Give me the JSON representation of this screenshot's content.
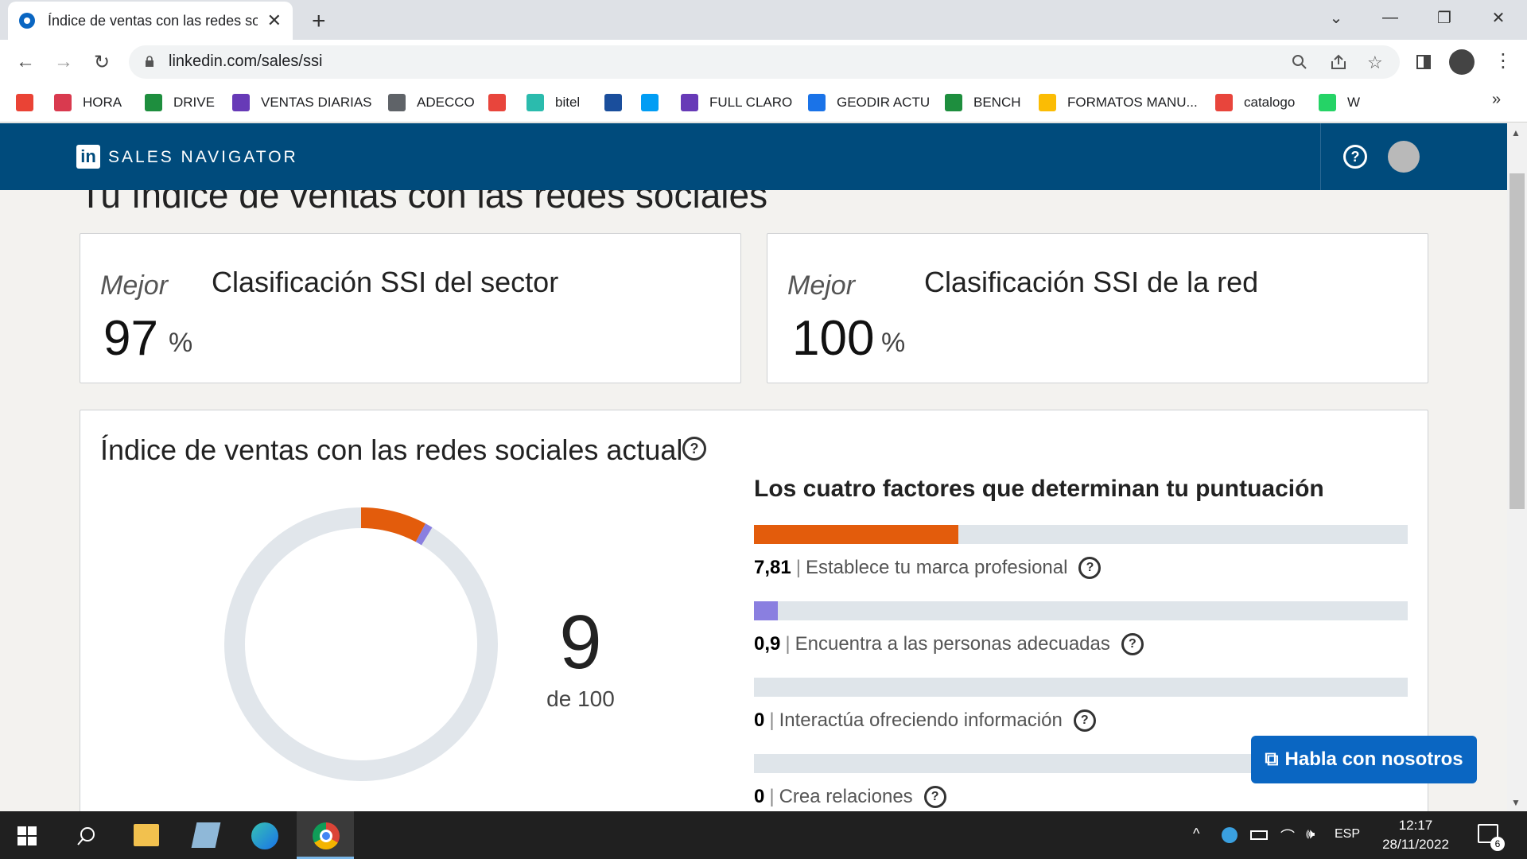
{
  "browser": {
    "tab_title": "Índice de ventas con las redes sociales",
    "new_tab": "+",
    "url": "linkedin.com/sales/ssi",
    "bookmarks": [
      {
        "label": "",
        "icon": "gmail-icon",
        "color": "#ea4335"
      },
      {
        "label": "HORA",
        "icon": "bookmark-icon",
        "color": "#d93a4f"
      },
      {
        "label": "DRIVE",
        "icon": "sheets-icon",
        "color": "#1e8e3e"
      },
      {
        "label": "VENTAS DIARIAS",
        "icon": "forms-icon",
        "color": "#673ab7"
      },
      {
        "label": "ADECCO",
        "icon": "globe-icon",
        "color": "#5f6368"
      },
      {
        "label": "",
        "icon": "people-icon",
        "color": "#e8453c"
      },
      {
        "label": "bitel",
        "icon": "chat-icon",
        "color": "#2bbbad"
      },
      {
        "label": "",
        "icon": "e-icon",
        "color": "#1a4e9c"
      },
      {
        "label": "",
        "icon": "movistar-icon",
        "color": "#019df4"
      },
      {
        "label": "FULL CLARO",
        "icon": "forms-icon",
        "color": "#673ab7"
      },
      {
        "label": "GEODIR ACTU",
        "icon": "geodir-icon",
        "color": "#1a73e8"
      },
      {
        "label": "BENCH",
        "icon": "sheets-icon",
        "color": "#1e8e3e"
      },
      {
        "label": "FORMATOS MANU...",
        "icon": "drive-icon",
        "color": "#fbbc04"
      },
      {
        "label": "catalogo",
        "icon": "people-icon",
        "color": "#e8453c"
      },
      {
        "label": "W",
        "icon": "whatsapp-icon",
        "color": "#25d366"
      }
    ],
    "more_bookmarks": "»"
  },
  "header": {
    "logo": "in",
    "product": "SALES NAVIGATOR"
  },
  "page": {
    "title": "Tu índice de ventas con las redes sociales",
    "industry": {
      "prefix": "Mejor",
      "value": "97",
      "unit": "%",
      "label": "Clasificación SSI del sector"
    },
    "network": {
      "prefix": "Mejor",
      "value": "100",
      "unit": "%",
      "label": "Clasificación SSI de la red"
    },
    "current": {
      "title": "Índice de ventas con las redes sociales actual",
      "score": "9",
      "score_of": "de 100",
      "factors_title": "Los cuatro factores que determinan tu puntuación",
      "factors": [
        {
          "value": "7,81",
          "label": "Establece tu marca profesional",
          "color": "#e35c0c",
          "fraction": 0.3124
        },
        {
          "value": "0,9",
          "label": "Encuentra a las personas adecuadas",
          "color": "#8a7fe0",
          "fraction": 0.036
        },
        {
          "value": "0",
          "label": "Interactúa ofreciendo información",
          "color": "#e35c0c",
          "fraction": 0
        },
        {
          "value": "0",
          "label": "Crea relaciones",
          "color": "#e35c0c",
          "fraction": 0
        }
      ]
    },
    "chat_button": "Habla con nosotros"
  },
  "chart_data": {
    "type": "pie",
    "title": "",
    "total": 100,
    "series": [
      {
        "value": 7.81,
        "color": "#e35c0c"
      },
      {
        "value": 0.9,
        "color": "#8a7fe0"
      },
      {
        "value": 0,
        "color": "#1f9bcf"
      },
      {
        "value": 0,
        "color": "#2ba38a"
      }
    ],
    "background_color": "#e1e6eb"
  },
  "taskbar": {
    "time": "12:17",
    "date": "28/11/2022",
    "language": "ESP",
    "notifications": "6"
  }
}
